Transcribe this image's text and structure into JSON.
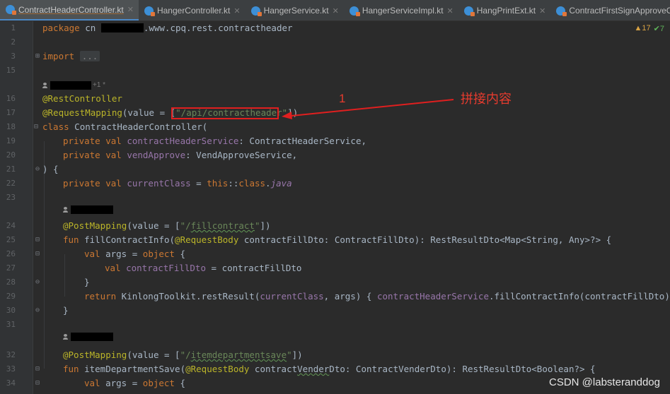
{
  "tabs": [
    {
      "label": "ContractHeaderController.kt",
      "active": true
    },
    {
      "label": "HangerController.kt",
      "active": false
    },
    {
      "label": "HangerService.kt",
      "active": false
    },
    {
      "label": "HangerServiceImpl.kt",
      "active": false
    },
    {
      "label": "HangPrintExt.kt",
      "active": false
    },
    {
      "label": "ContractFirstSignApproveC",
      "active": false
    }
  ],
  "inspections": {
    "warnings": "▲17",
    "ok": "✔7"
  },
  "code": {
    "package_kw": "package",
    "package_prefix": "cn",
    "package_suffix": ".www.cpq.rest.contractheader",
    "import_kw": "import",
    "import_fold": "...",
    "author_suffix": "+1 *",
    "rest_controller": "@RestController",
    "request_mapping": "@RequestMapping",
    "request_mapping_args_pre": "(value = [",
    "request_mapping_path": "\"/api/contractheader\"",
    "request_mapping_args_post": "])",
    "class_kw": "class",
    "class_name": " ContractHeaderController(",
    "pv1_kw": "private val",
    "pv1_name": "contractHeaderService",
    "pv1_type": ": ContractHeaderService,",
    "pv2_kw": "private val",
    "pv2_name": "vendApprove",
    "pv2_type": ": VendApproveService,",
    "ctor_close": ") {",
    "cc_kw": "private val",
    "cc_name": "currentClass",
    "cc_eq": " = ",
    "cc_this": "this",
    "cc_ref": "::",
    "cc_class": "class",
    "cc_dot": ".",
    "cc_java": "java",
    "post_mapping": "@PostMapping",
    "pm1_pre": "(value = [",
    "pm1_path_q": "\"/",
    "pm1_path": "fillcontract",
    "pm1_path_end": "\"",
    "pm1_post": "])",
    "fun1_kw": "fun",
    "fun1_name": " fillContractInfo(",
    "fun1_ann": "@RequestBody",
    "fun1_rest": " contractFillDto: ContractFillDto): RestResultDto<Map<String, Any>?> {",
    "args_kw": "val",
    "args_rest": " args = ",
    "args_obj": "object",
    "args_brace": " {",
    "inner_kw": "val",
    "inner_name": " contractFillDto",
    "inner_rest": " = contractFillDto",
    "close_brace": "}",
    "return_kw": "return",
    "return_pre": " KinlongToolkit.restResult(",
    "return_cc": "currentClass",
    "return_mid": ", args) { ",
    "return_svc": "contractHeaderService",
    "return_post": ".fillContractInfo(contractFillDto) }",
    "pm2_path_q": "\"/",
    "pm2_path": "itemdepartmentsave",
    "pm2_path_end": "\"",
    "fun2_name": " itemDepartmentSave(",
    "fun2_param_pre": " contract",
    "fun2_param_und": "Vender",
    "fun2_rest": "Dto: ContractVenderDto): RestResultDto<Boolean?> {",
    "args2_obj": "object",
    "args2_brace": " {"
  },
  "line_numbers": [
    "1",
    "2",
    "3",
    "15",
    "",
    "16",
    "17",
    "18",
    "19",
    "20",
    "21",
    "22",
    "23",
    "",
    "24",
    "25",
    "26",
    "27",
    "28",
    "29",
    "30",
    "31",
    "",
    "32",
    "33",
    "34"
  ],
  "annotation": {
    "number": "1",
    "text": "拼接内容"
  },
  "watermark": "CSDN @labsteranddog"
}
